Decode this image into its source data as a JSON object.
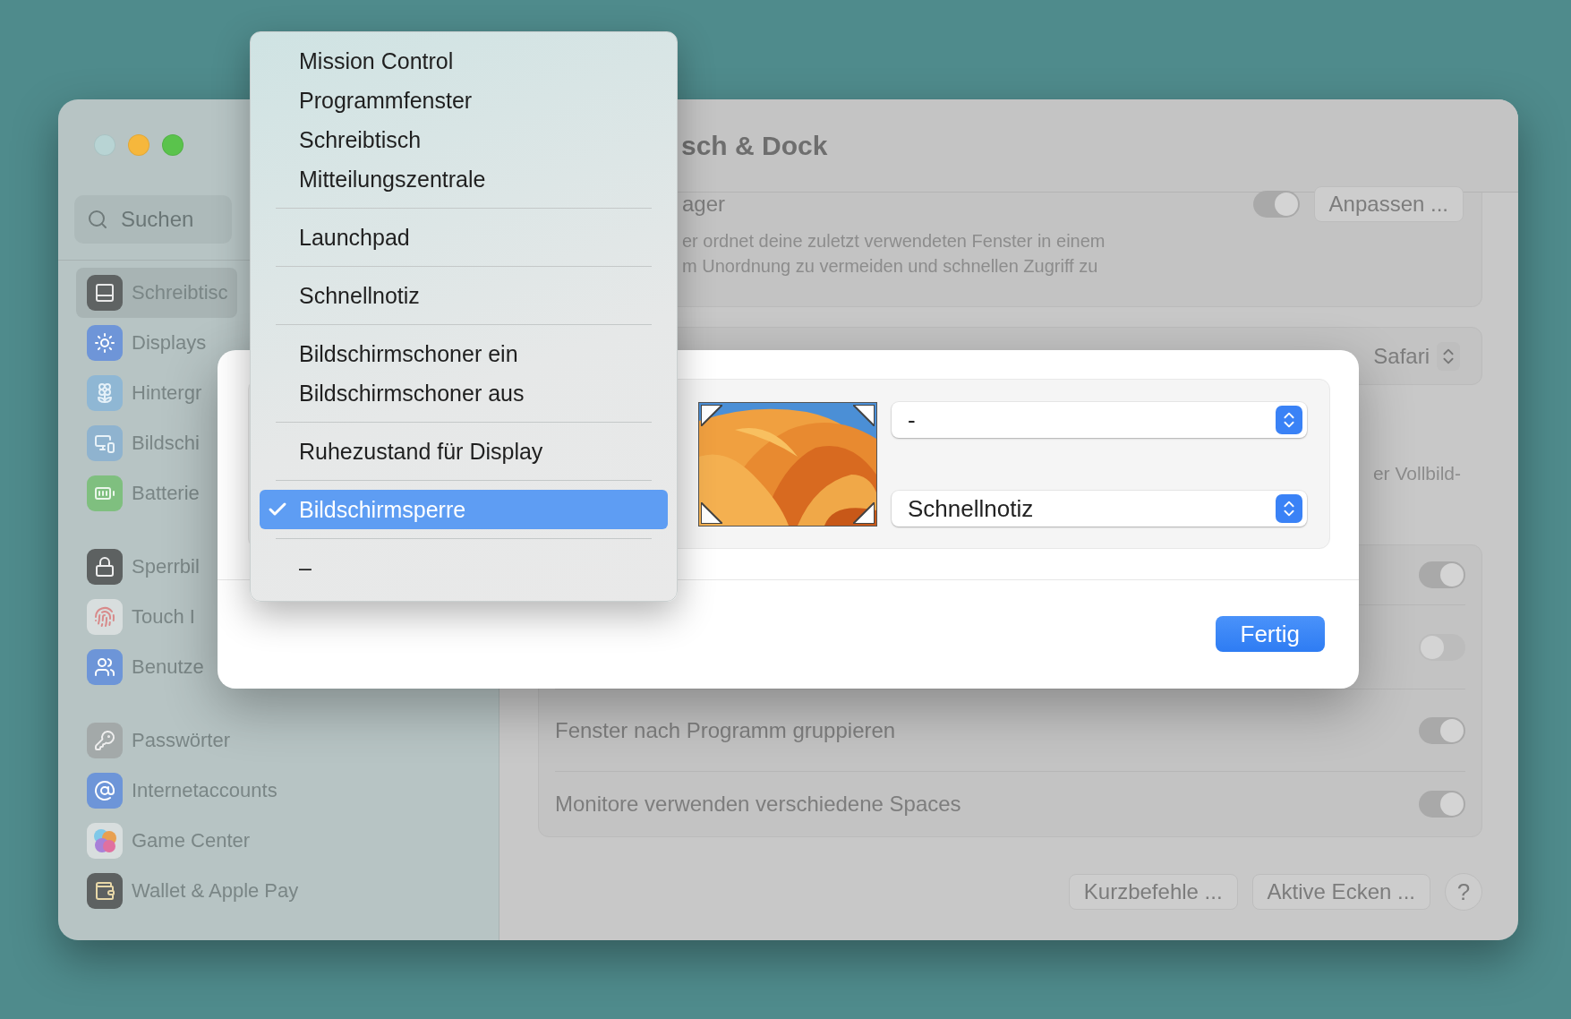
{
  "window": {
    "title": "sch & Dock"
  },
  "sidebar": {
    "search": {
      "placeholder": "Suchen"
    },
    "groups": [
      {
        "items": [
          {
            "label": "Schreibtisc",
            "selected": true
          },
          {
            "label": "Displays",
            "selected": false
          },
          {
            "label": "Hintergr",
            "selected": false
          },
          {
            "label": "Bildschi",
            "selected": false
          },
          {
            "label": "Batterie",
            "selected": false
          }
        ]
      },
      {
        "items": [
          {
            "label": "Sperrbil",
            "selected": false
          },
          {
            "label": "Touch I",
            "selected": false
          },
          {
            "label": "Benutze",
            "selected": false
          }
        ]
      },
      {
        "items": [
          {
            "label": "Passwörter",
            "selected": false
          },
          {
            "label": "Internetaccounts",
            "selected": false
          },
          {
            "label": "Game Center",
            "selected": false
          },
          {
            "label": "Wallet & Apple Pay",
            "selected": false
          }
        ]
      }
    ]
  },
  "content": {
    "stage_manager": {
      "label": "ager",
      "on": true,
      "button": "Anpassen ...",
      "description": [
        "er ordnet deine zuletzt verwendeten Fenster in einem",
        "m Unordnung zu vermeiden und schnellen Zugriff zu"
      ]
    },
    "browser": {
      "value": "Safari"
    },
    "fullscreen_text": "er Vollbild-",
    "toggle_rows": [
      {
        "on": true
      },
      {
        "on": false
      },
      {
        "label": "Fenster nach Programm gruppieren",
        "on": true
      },
      {
        "label": "Monitore verwenden verschiedene Spaces",
        "on": true
      }
    ],
    "buttons": [
      "Kurzbefehle ...",
      "Aktive Ecken ..."
    ],
    "help": "?"
  },
  "dialog": {
    "selects": [
      {
        "value": "-"
      },
      {
        "value": "Schnellnotiz"
      }
    ],
    "button": "Fertig"
  },
  "menu": {
    "sections": [
      {
        "items": [
          {
            "label": "Mission Control",
            "selected": false
          },
          {
            "label": "Programmfenster",
            "selected": false
          },
          {
            "label": "Schreibtisch",
            "selected": false
          },
          {
            "label": "Mitteilungszentrale",
            "selected": false
          }
        ]
      },
      {
        "items": [
          {
            "label": "Launchpad",
            "selected": false
          }
        ]
      },
      {
        "items": [
          {
            "label": "Schnellnotiz",
            "selected": false
          }
        ]
      },
      {
        "items": [
          {
            "label": "Bildschirmschoner ein",
            "selected": false
          },
          {
            "label": "Bildschirmschoner aus",
            "selected": false
          }
        ]
      },
      {
        "items": [
          {
            "label": "Ruhezustand für Display",
            "selected": false
          }
        ]
      },
      {
        "items": [
          {
            "label": "Bildschirmsperre",
            "selected": true
          }
        ]
      },
      {
        "items": [
          {
            "label": "–",
            "selected": false
          }
        ]
      }
    ]
  }
}
